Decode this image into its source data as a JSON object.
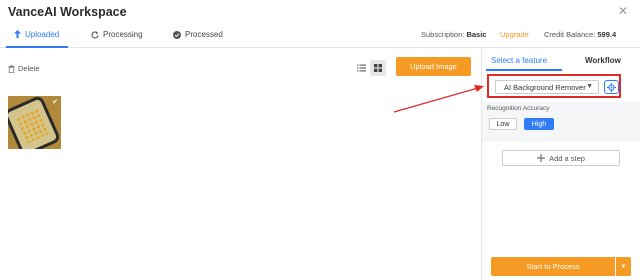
{
  "app": {
    "title": "VanceAI Workspace"
  },
  "tabs": [
    {
      "label": "Uploaded",
      "icon": "upload-icon",
      "active": true
    },
    {
      "label": "Processing",
      "icon": "refresh-icon",
      "active": false
    },
    {
      "label": "Processed",
      "icon": "check-circle-icon",
      "active": false
    }
  ],
  "account": {
    "subscription_label": "Subscription:",
    "subscription_value": "Basic",
    "upgrade_label": "Upgrade",
    "credit_label": "Credit Balance:",
    "credit_value": "599.4"
  },
  "toolbar": {
    "delete_label": "Delete",
    "upload_label": "Upload Image"
  },
  "right_panel": {
    "tab_feature": "Select a feature",
    "tab_workflow": "Workflow",
    "feature_selected": "AI Background Remover",
    "recognition_label": "Recognition Accuracy",
    "accuracy_options": [
      "Low",
      "High"
    ],
    "accuracy_selected": "High",
    "add_step_label": "Add a step",
    "start_label": "Start to Process"
  },
  "colors": {
    "accent_blue": "#2f7cf6",
    "accent_orange": "#f59a23",
    "highlight_red": "#e02a2a"
  }
}
